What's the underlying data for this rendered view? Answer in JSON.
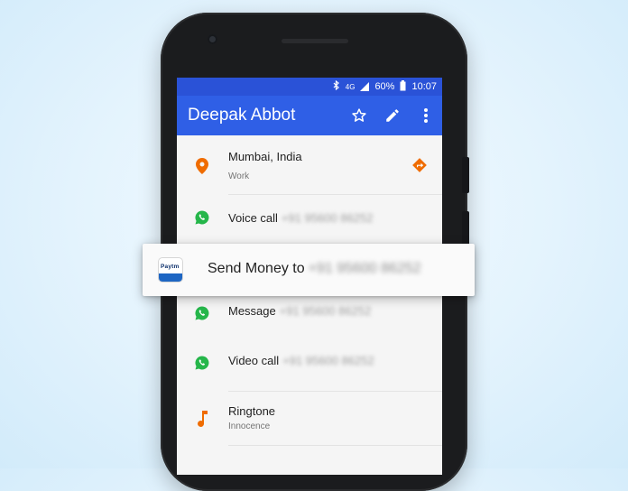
{
  "status_bar": {
    "network": "4G",
    "battery": "60%",
    "time": "10:07"
  },
  "toolbar": {
    "title": "Deepak Abbot"
  },
  "rows": [
    {
      "primary": "Mumbai, India",
      "secondary": "Work"
    },
    {
      "primary": "Voice call",
      "number": "+91 95600 86252"
    },
    {
      "primary": "Message",
      "number": "+91 95600 86252"
    },
    {
      "primary": "Video call",
      "number": "+91 95600 86252"
    },
    {
      "primary": "Ringtone",
      "secondary": "Innocence"
    }
  ],
  "popup": {
    "app_logo_text": "Paytm",
    "label": "Send Money to",
    "number": "+91 95600 86252"
  },
  "colors": {
    "appbar": "#2f5fe6",
    "statusbar": "#2a52d7",
    "accent_orange": "#ef6c00",
    "whatsapp_green": "#25b64a"
  }
}
